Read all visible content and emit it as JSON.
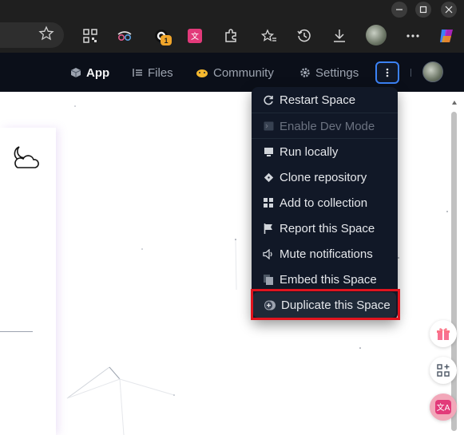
{
  "browser": {
    "window_controls": [
      "minimize",
      "maximize",
      "close"
    ],
    "toolbar_badge": "1"
  },
  "space_nav": {
    "tabs": [
      {
        "label": "App",
        "active": true
      },
      {
        "label": "Files",
        "active": false
      },
      {
        "label": "Community",
        "active": false
      },
      {
        "label": "Settings",
        "active": false
      }
    ]
  },
  "menu": {
    "items": [
      {
        "label": "Restart Space",
        "icon": "restart-icon",
        "disabled": false
      },
      {
        "label": "Enable Dev Mode",
        "icon": "terminal-icon",
        "disabled": true
      },
      {
        "label": "Run locally",
        "icon": "monitor-icon",
        "disabled": false
      },
      {
        "label": "Clone repository",
        "icon": "git-icon",
        "disabled": false
      },
      {
        "label": "Add to collection",
        "icon": "collection-icon",
        "disabled": false
      },
      {
        "label": "Report this Space",
        "icon": "flag-icon",
        "disabled": false
      },
      {
        "label": "Mute notifications",
        "icon": "mute-icon",
        "disabled": false
      },
      {
        "label": "Embed this Space",
        "icon": "embed-icon",
        "disabled": false
      },
      {
        "label": "Duplicate this Space",
        "icon": "duplicate-icon",
        "disabled": false,
        "highlighted": true
      }
    ]
  },
  "colors": {
    "nav_bg": "#0b0f19",
    "menu_bg": "#111827",
    "highlight_border": "#e0141e",
    "kebab_border": "#3b82f6"
  }
}
